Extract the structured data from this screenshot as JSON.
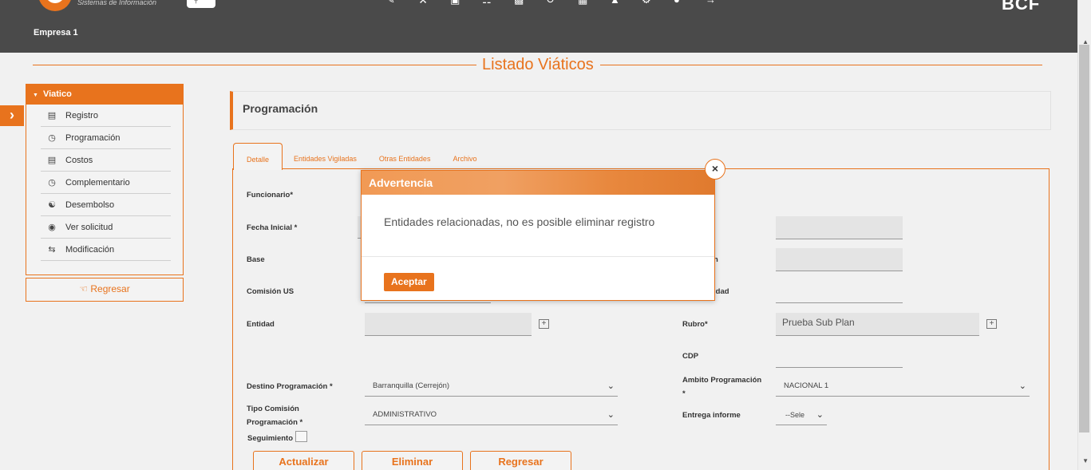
{
  "header": {
    "logo_subtitle": "Sistemas de Información",
    "company": "Empresa 1",
    "brand": "BCF"
  },
  "page_title": "Listado Viáticos",
  "sidebar": {
    "section": "Viatico",
    "items": [
      {
        "label": "Registro",
        "icon": "list-icon"
      },
      {
        "label": "Programación",
        "icon": "clock-icon"
      },
      {
        "label": "Costos",
        "icon": "money-icon"
      },
      {
        "label": "Complementario",
        "icon": "clock-icon"
      },
      {
        "label": "Desembolso",
        "icon": "coins-icon"
      },
      {
        "label": "Ver solicitud",
        "icon": "eye-icon"
      },
      {
        "label": "Modificación",
        "icon": "swap-icon"
      }
    ],
    "back_label": "Regresar"
  },
  "panel_title": "Programación",
  "tabs": [
    "Detalle",
    "Entidades Vigiladas",
    "Otras Entidades",
    "Archivo"
  ],
  "form": {
    "funcionario_label": "Funcionario*",
    "fecha_inicial_label": "Fecha Inicial *",
    "base_label": "Base",
    "comision_label": "Comisión US",
    "entidad_label": "Entidad",
    "rubro_label": "Rubro*",
    "rubro_value": "Prueba Sub Plan",
    "cdp_label": "CDP",
    "partial_label_1": "n",
    "partial_label_2": "idad",
    "destino_label": "Destino Programación *",
    "destino_value": "Barranquilla (Cerrejón)",
    "ambito_label_1": "Ambito Programación",
    "ambito_label_2": "*",
    "ambito_value": "NACIONAL 1",
    "tipo_label_1": "Tipo Comisión",
    "tipo_label_2": "Programación *",
    "tipo_value": "ADMINISTRATIVO",
    "entrega_label": "Entrega informe",
    "entrega_value": "--Sele",
    "seguimiento_label": "Seguimiento"
  },
  "buttons": {
    "actualizar": "Actualizar",
    "eliminar": "Eliminar",
    "regresar": "Regresar"
  },
  "modal": {
    "title": "Advertencia",
    "message": "Entidades relacionadas, no es posible eliminar registro",
    "ok_label": "Aceptar",
    "close_glyph": "×"
  },
  "colors": {
    "accent": "#e8731d",
    "topbar": "#4a4a4a",
    "background": "#f1f1f1"
  }
}
